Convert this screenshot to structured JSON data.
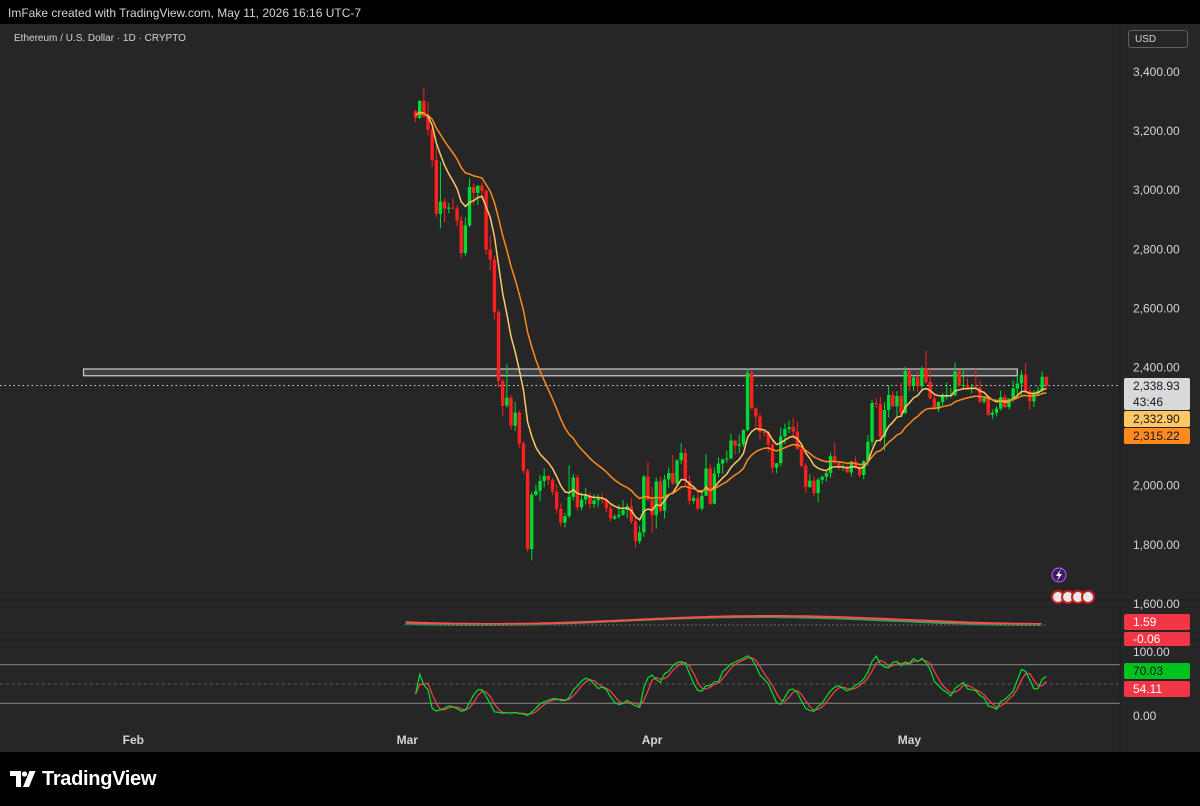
{
  "header": {
    "attribution": "ImFake created with TradingView.com, May 11, 2026 16:16 UTC-7"
  },
  "legend": {
    "symbol": "Ethereum / U.S. Dollar · 1D · CRYPTO"
  },
  "axis": {
    "currency": "USD",
    "countdown": "43:46"
  },
  "brand": {
    "name": "TradingView",
    "logo_icon": "tradingview-logo-icon"
  },
  "colors": {
    "background": "#262626",
    "up": "#00d932",
    "down": "#ff1f1f",
    "ema_fast": "#ffc864",
    "ema_slow": "#ff8a1e",
    "zone": "#ffffff",
    "stoch_k": "#00e02d",
    "stoch_d": "#ff3d4f",
    "macd": "#ff4d4d",
    "macd_signal": "#26a65b"
  },
  "chart_data": {
    "type": "candlestick",
    "title": "Ethereum / U.S. Dollar · 1D · CRYPTO",
    "x_ticks": [
      "Feb",
      "Mar",
      "Apr",
      "May"
    ],
    "x_tick_index": [
      29,
      95,
      154,
      216
    ],
    "price_axis": {
      "ticks": [
        3400,
        3200,
        3000,
        2800,
        2600,
        2400,
        2000,
        1800,
        1600
      ],
      "tick_labels": [
        "3,400.00",
        "3,200.00",
        "3,000.00",
        "2,800.00",
        "2,600.00",
        "2,400.00",
        "2,000.00",
        "1,800.00",
        "1,600.00"
      ],
      "ylim": [
        1490,
        3590
      ],
      "grid": false
    },
    "resistance_zone": {
      "low": 2372,
      "high": 2395,
      "start_index": 17,
      "end_index": 242
    },
    "last_price_line": 2338.93,
    "price_labels": [
      {
        "text": "2,338.93",
        "value": 2338.93,
        "role": "last_price"
      },
      {
        "text": "2,332.90",
        "value": 2332.9,
        "role": "ema_fast"
      },
      {
        "text": "2,315.22",
        "value": 2315.22,
        "role": "ema_slow"
      }
    ],
    "candles_ohlc": [
      [
        3268,
        3272,
        3231,
        3245
      ],
      [
        3245,
        3305,
        3241,
        3302
      ],
      [
        3302,
        3345,
        3245,
        3248
      ],
      [
        3248,
        3300,
        3186,
        3205
      ],
      [
        3205,
        3215,
        3080,
        3102
      ],
      [
        3102,
        3151,
        2909,
        2920
      ],
      [
        2920,
        3095,
        2871,
        2961
      ],
      [
        2961,
        2972,
        2893,
        2938
      ],
      [
        2938,
        2957,
        2922,
        2941
      ],
      [
        2941,
        2973,
        2935,
        2938
      ],
      [
        2938,
        2949,
        2878,
        2897
      ],
      [
        2897,
        2912,
        2771,
        2787
      ],
      [
        2787,
        2908,
        2778,
        2881
      ],
      [
        2881,
        3040,
        2875,
        3011
      ],
      [
        3011,
        3022,
        2950,
        2991
      ],
      [
        2991,
        3017,
        2950,
        3015
      ],
      [
        3015,
        3026,
        2970,
        2998
      ],
      [
        2998,
        3002,
        2781,
        2799
      ],
      [
        2799,
        2844,
        2729,
        2765
      ],
      [
        2765,
        2779,
        2561,
        2587
      ],
      [
        2587,
        2597,
        2332,
        2355
      ],
      [
        2355,
        2362,
        2236,
        2271
      ],
      [
        2271,
        2410,
        2264,
        2298
      ],
      [
        2298,
        2307,
        2188,
        2203
      ],
      [
        2203,
        2284,
        2185,
        2247
      ],
      [
        2247,
        2255,
        2128,
        2143
      ],
      [
        2143,
        2150,
        2040,
        2051
      ],
      [
        2051,
        2057,
        1777,
        1786
      ],
      [
        1786,
        1979,
        1747,
        1969
      ],
      [
        1969,
        2003,
        1965,
        1983
      ],
      [
        1983,
        2036,
        1947,
        2016
      ],
      [
        2016,
        2059,
        1994,
        2033
      ],
      [
        2033,
        2036,
        2002,
        2020
      ],
      [
        2020,
        2026,
        1969,
        1980
      ],
      [
        1980,
        2003,
        1906,
        1921
      ],
      [
        1921,
        1940,
        1862,
        1875
      ],
      [
        1875,
        1908,
        1858,
        1897
      ],
      [
        1897,
        2069,
        1890,
        1962
      ],
      [
        1962,
        2040,
        1950,
        2028
      ],
      [
        2028,
        2037,
        1916,
        1927
      ],
      [
        1927,
        1976,
        1916,
        1953
      ],
      [
        1953,
        1992,
        1936,
        1967
      ],
      [
        1967,
        1978,
        1922,
        1938
      ],
      [
        1938,
        1972,
        1925,
        1950
      ],
      [
        1950,
        1970,
        1927,
        1958
      ],
      [
        1958,
        1975,
        1939,
        1952
      ],
      [
        1952,
        1960,
        1910,
        1923
      ],
      [
        1923,
        1941,
        1879,
        1889
      ],
      [
        1889,
        1903,
        1884,
        1896
      ],
      [
        1896,
        1936,
        1889,
        1902
      ],
      [
        1902,
        1952,
        1898,
        1918
      ],
      [
        1918,
        1940,
        1890,
        1930
      ],
      [
        1930,
        1958,
        1871,
        1879
      ],
      [
        1879,
        1894,
        1791,
        1812
      ],
      [
        1812,
        1864,
        1803,
        1842
      ],
      [
        1842,
        2036,
        1827,
        2031
      ],
      [
        2031,
        2081,
        1949,
        1952
      ],
      [
        1952,
        1996,
        1840,
        1900
      ],
      [
        1900,
        2027,
        1855,
        2014
      ],
      [
        2014,
        2030,
        1909,
        1915
      ],
      [
        1915,
        2036,
        1889,
        2021
      ],
      [
        2021,
        2062,
        1994,
        2043
      ],
      [
        2043,
        2104,
        2002,
        2008
      ],
      [
        2008,
        2089,
        1998,
        2086
      ],
      [
        2086,
        2145,
        2072,
        2111
      ],
      [
        2111,
        2128,
        1999,
        2016
      ],
      [
        2016,
        2035,
        1937,
        1949
      ],
      [
        1949,
        1967,
        1939,
        1958
      ],
      [
        1958,
        1979,
        1916,
        1923
      ],
      [
        1923,
        1982,
        1916,
        1966
      ],
      [
        1966,
        2106,
        1965,
        2058
      ],
      [
        2058,
        2074,
        1934,
        1939
      ],
      [
        1939,
        2062,
        1936,
        2042
      ],
      [
        2042,
        2096,
        2028,
        2075
      ],
      [
        2075,
        2091,
        2040,
        2089
      ],
      [
        2089,
        2118,
        2077,
        2092
      ],
      [
        2092,
        2175,
        2091,
        2153
      ],
      [
        2153,
        2154,
        2106,
        2135
      ],
      [
        2135,
        2173,
        2111,
        2140
      ],
      [
        2140,
        2191,
        2131,
        2189
      ],
      [
        2189,
        2397,
        2184,
        2381
      ],
      [
        2381,
        2390,
        2258,
        2262
      ],
      [
        2262,
        2264,
        2198,
        2234
      ],
      [
        2234,
        2247,
        2156,
        2182
      ],
      [
        2182,
        2188,
        2167,
        2179
      ],
      [
        2179,
        2186,
        2113,
        2139
      ],
      [
        2139,
        2151,
        2041,
        2061
      ],
      [
        2061,
        2077,
        2042,
        2076
      ],
      [
        2076,
        2197,
        2065,
        2167
      ],
      [
        2167,
        2210,
        2142,
        2192
      ],
      [
        2192,
        2220,
        2178,
        2198
      ],
      [
        2198,
        2231,
        2158,
        2183
      ],
      [
        2183,
        2217,
        2122,
        2125
      ],
      [
        2125,
        2131,
        2063,
        2067
      ],
      [
        2067,
        2075,
        1976,
        1995
      ],
      [
        1995,
        2040,
        1993,
        2017
      ],
      [
        2017,
        2032,
        1964,
        1975
      ],
      [
        1975,
        2026,
        1944,
        2020
      ],
      [
        2020,
        2034,
        2007,
        2030
      ],
      [
        2030,
        2053,
        2014,
        2043
      ],
      [
        2043,
        2112,
        2027,
        2100
      ],
      [
        2100,
        2146,
        2071,
        2077
      ],
      [
        2077,
        2077,
        2053,
        2061
      ],
      [
        2061,
        2072,
        2050,
        2064
      ],
      [
        2064,
        2072,
        2043,
        2045
      ],
      [
        2045,
        2084,
        2032,
        2082
      ],
      [
        2082,
        2100,
        2057,
        2063
      ],
      [
        2063,
        2075,
        2029,
        2036
      ],
      [
        2036,
        2087,
        2022,
        2083
      ],
      [
        2083,
        2171,
        2068,
        2149
      ],
      [
        2149,
        2290,
        2136,
        2280
      ],
      [
        2280,
        2296,
        2263,
        2277
      ],
      [
        2277,
        2301,
        2147,
        2165
      ],
      [
        2165,
        2283,
        2118,
        2256
      ],
      [
        2256,
        2340,
        2231,
        2307
      ],
      [
        2307,
        2320,
        2267,
        2269
      ],
      [
        2269,
        2320,
        2236,
        2304
      ],
      [
        2304,
        2349,
        2237,
        2246
      ],
      [
        2246,
        2403,
        2242,
        2388
      ],
      [
        2388,
        2392,
        2320,
        2337
      ],
      [
        2337,
        2374,
        2321,
        2366
      ],
      [
        2366,
        2387,
        2318,
        2337
      ],
      [
        2337,
        2404,
        2324,
        2396
      ],
      [
        2396,
        2458,
        2343,
        2351
      ],
      [
        2351,
        2398,
        2294,
        2295
      ],
      [
        2295,
        2307,
        2257,
        2260
      ],
      [
        2260,
        2286,
        2249,
        2283
      ],
      [
        2283,
        2314,
        2271,
        2304
      ],
      [
        2304,
        2350,
        2292,
        2304
      ],
      [
        2304,
        2331,
        2298,
        2306
      ],
      [
        2306,
        2417,
        2302,
        2387
      ],
      [
        2387,
        2392,
        2336,
        2339
      ],
      [
        2339,
        2395,
        2330,
        2341
      ],
      [
        2341,
        2363,
        2325,
        2330
      ],
      [
        2330,
        2344,
        2313,
        2333
      ],
      [
        2333,
        2396,
        2325,
        2332
      ],
      [
        2332,
        2356,
        2279,
        2284
      ],
      [
        2284,
        2301,
        2277,
        2296
      ],
      [
        2296,
        2300,
        2236,
        2240
      ],
      [
        2240,
        2258,
        2226,
        2247
      ],
      [
        2247,
        2269,
        2234,
        2261
      ],
      [
        2261,
        2322,
        2254,
        2300
      ],
      [
        2300,
        2310,
        2262,
        2266
      ],
      [
        2266,
        2296,
        2258,
        2295
      ],
      [
        2295,
        2356,
        2283,
        2329
      ],
      [
        2329,
        2372,
        2304,
        2346
      ],
      [
        2346,
        2390,
        2307,
        2376
      ],
      [
        2376,
        2415,
        2312,
        2319
      ],
      [
        2319,
        2335,
        2256,
        2286
      ],
      [
        2286,
        2323,
        2266,
        2313
      ],
      [
        2313,
        2335,
        2303,
        2322
      ],
      [
        2322,
        2386,
        2314,
        2369
      ],
      [
        2369,
        2370,
        2326,
        2339
      ]
    ],
    "indices": [
      0,
      1,
      2,
      3,
      4,
      5,
      6,
      7,
      8,
      9,
      10,
      11,
      12,
      13,
      14,
      15,
      16,
      17,
      18,
      19,
      20,
      21,
      22,
      23,
      24,
      25,
      26,
      27,
      28,
      29,
      30,
      31,
      32,
      33,
      34,
      35,
      36,
      37,
      38,
      39,
      40,
      41,
      42,
      43,
      44,
      45,
      46,
      47,
      48,
      49,
      50,
      51,
      52,
      53,
      54,
      55,
      56,
      57,
      58,
      59,
      60,
      61,
      62,
      63,
      64,
      65,
      66,
      67,
      68,
      69,
      70,
      71,
      72,
      73,
      74,
      75,
      76,
      77,
      78,
      79,
      80,
      81,
      82,
      83,
      84,
      85,
      86,
      87,
      88,
      89,
      90,
      91,
      92,
      93,
      94,
      95,
      96,
      97,
      98,
      99,
      100,
      101,
      102,
      103,
      104,
      105,
      106,
      107,
      108,
      109,
      110,
      111,
      112,
      113,
      114,
      115,
      116,
      117,
      118,
      119,
      120,
      121,
      122,
      123,
      124,
      125,
      126,
      127,
      128,
      129,
      130,
      131,
      132,
      133,
      134,
      135,
      136,
      137,
      138,
      139,
      140,
      141,
      142,
      143,
      144,
      145,
      146,
      147,
      148,
      149,
      150,
      151,
      152,
      153,
      154,
      155,
      156,
      157,
      158,
      159,
      160,
      161,
      162,
      163,
      164,
      165,
      166,
      167,
      168,
      169,
      170,
      171,
      172,
      173,
      174,
      175,
      176,
      177,
      178,
      179,
      180,
      181,
      182,
      183,
      184,
      185,
      186,
      187,
      188,
      189,
      190,
      191,
      192,
      193,
      194,
      195,
      196,
      197,
      198,
      199,
      200,
      201,
      202,
      203,
      204,
      205,
      206,
      207,
      208,
      209,
      210,
      211,
      212,
      213,
      214,
      215,
      216,
      217,
      218,
      219,
      220,
      221,
      222,
      223,
      224,
      225,
      226,
      227,
      228,
      229,
      230,
      231,
      232,
      233,
      234,
      235,
      236,
      237,
      238,
      239,
      240,
      241,
      242,
      243,
      244,
      245,
      246,
      247,
      248,
      249
    ],
    "series": [
      {
        "type": "ema",
        "role": "fast",
        "period": 9
      },
      {
        "type": "ema",
        "role": "slow",
        "period": 21
      }
    ],
    "macd_panel": {
      "labels": [
        {
          "text": "1.59",
          "value": 1.59,
          "role": "macd"
        },
        {
          "text": "-0.06",
          "value": -0.06,
          "role": "histogram"
        }
      ]
    },
    "stoch_panel": {
      "ticks": [
        100,
        0
      ],
      "tick_labels": [
        "100.00",
        "0.00"
      ],
      "levels": [
        80,
        50,
        20
      ],
      "labels": [
        {
          "text": "70.03",
          "value": 70.03,
          "role": "k"
        },
        {
          "text": "54.11",
          "value": 54.11,
          "role": "d"
        }
      ]
    }
  }
}
